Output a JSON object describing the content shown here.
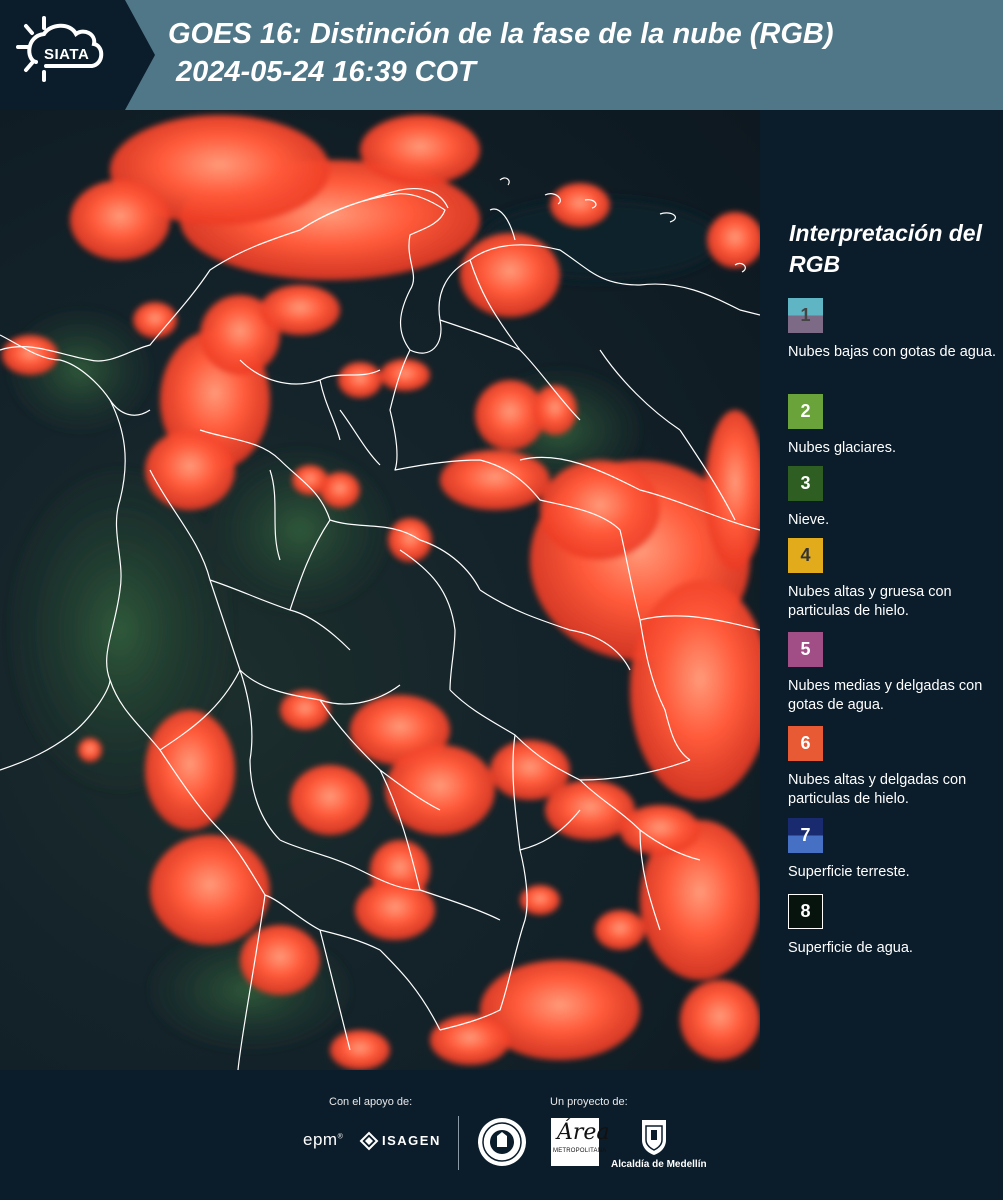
{
  "header": {
    "logo_text": "SIATA",
    "title": "GOES 16: Distinción de la fase de la nube (RGB)",
    "subtitle": "2024-05-24 16:39 COT"
  },
  "legend": {
    "title": "Interpretación del RGB",
    "items": [
      {
        "number": "1",
        "label": "Nubes bajas con gotas de agua.",
        "color_top": "#5fb5c4",
        "color_bottom": "#7d6a86",
        "text_color": "#444444"
      },
      {
        "number": "2",
        "label": "Nubes glaciares.",
        "color": "#6aa33a",
        "text_color": "#ffffff"
      },
      {
        "number": "3",
        "label": "Nieve.",
        "color": "#2e5e22",
        "text_color": "#ffffff"
      },
      {
        "number": "4",
        "label": "Nubes altas y gruesa con particulas de hielo.",
        "color": "#e1ab1c",
        "text_color": "#333333"
      },
      {
        "number": "5",
        "label": "Nubes medias y delgadas con gotas de agua.",
        "color": "#a14d86",
        "text_color": "#ffffff"
      },
      {
        "number": "6",
        "label": "Nubes altas y delgadas con particulas de hielo.",
        "color": "#e85a33",
        "text_color": "#ffffff"
      },
      {
        "number": "7",
        "label": "Superficie terreste.",
        "color_top": "#1a2a6e",
        "color_bottom": "#4570c4",
        "text_color": "#ffffff"
      },
      {
        "number": "8",
        "label": "Superficie de agua.",
        "color": "#07130d",
        "text_color": "#ffffff"
      }
    ]
  },
  "footer": {
    "support_label": "Con el apoyo de:",
    "project_label": "Un proyecto de:",
    "epm": "epm",
    "isagen": "ISAGEN",
    "area_mark": "Área",
    "area_sub": "METROPOLITANA",
    "alcaldia": "Alcaldía de Medellín"
  },
  "colors": {
    "header_bg": "#4f7787",
    "panel_bg": "#0b1c2b",
    "cloud_red": "#ff4a2e",
    "border_white": "#ffffff"
  }
}
